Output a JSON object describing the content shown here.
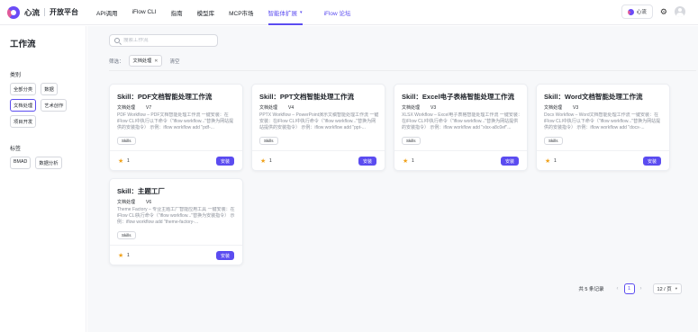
{
  "brand": {
    "name": "心流",
    "sub": "开放平台"
  },
  "nav": {
    "items": [
      {
        "label": "API调用"
      },
      {
        "label": "iFlow CLI"
      },
      {
        "label": "指南"
      },
      {
        "label": "模型库"
      },
      {
        "label": "MCP市场"
      }
    ],
    "active": {
      "label": "智能体扩展",
      "caret": "▾"
    },
    "forum": {
      "label": "iFlow 论坛"
    },
    "user_label": "心流",
    "icons": {
      "settings": "gear-icon",
      "avatar": "avatar-icon"
    }
  },
  "sidebar": {
    "title": "工作流",
    "category_title": "类别",
    "categories": [
      "全部分类",
      "数据",
      "文档处理",
      "艺术创作",
      "项目开发"
    ],
    "selected_category": "文档处理",
    "tag_title": "标签",
    "tags": [
      "BMAD",
      "数据分析"
    ]
  },
  "search": {
    "placeholder": "搜索工作流",
    "value": ""
  },
  "filter": {
    "label": "筛选：",
    "chip": "文档处理",
    "clear": "清空"
  },
  "cards": [
    {
      "title": "Skill：PDF文档智能处理工作流",
      "category": "文档处理",
      "version": "V7",
      "desc": "PDF Workflow – PDF文档智能处理工作流 一键安装：在iFlow CLI中执行以下命令（\"iflow workflow...\"替换为网站提供的安装指令）  示例：iflow workflow add \"pdf-...",
      "tag": "Skills",
      "stars": "1",
      "install": "安装"
    },
    {
      "title": "Skill：PPT文档智能处理工作流",
      "category": "文档处理",
      "version": "V4",
      "desc": "PPTX Workflow – PowerPoint演示文稿智能处理工作流 一键安装：在iFlow CLI中执行命令（\"iflow workflow...\"替换为网站提供的安装指令）  示例：iflow workflow add \"ppt-...",
      "tag": "Skills",
      "stars": "1",
      "install": "安装"
    },
    {
      "title": "Skill：Excel电子表格智能处理工作流",
      "category": "文档处理",
      "version": "V3",
      "desc": "XLSX Workflow – Excel电子表格智能处理工作流 一键安装：在iFlow CLI中执行命令（\"iflow workflow...\"替换为网站提供的安装指令）  示例：iflow workflow add \"xlsx-a8c0ef\"...",
      "tag": "Skills",
      "stars": "1",
      "install": "安装"
    },
    {
      "title": "Skill：Word文档智能处理工作流",
      "category": "文档处理",
      "version": "V3",
      "desc": "Docx Workflow – Word文档智能处理工作流 一键安装：在iFlow CLI中执行以下命令（\"iflow workflow...\"替换为网站提供的安装指令）  示例：iflow workflow add \"docx-...",
      "tag": "Skills",
      "stars": "1",
      "install": "安装"
    },
    {
      "title": "Skill：主题工厂",
      "category": "文档处理",
      "version": "V6",
      "desc": "Theme Factory – 专业主题工厂智能应用工具 一键安装：在iFlow CLI执行命令（\"iflow workflow...\"替换为安装指令）  示例：iflow workflow add \"theme-factory-...",
      "tag": "Skills",
      "stars": "1",
      "install": "安装"
    }
  ],
  "pagination": {
    "total": "共 5 条记录",
    "prev": "‹",
    "page": "1",
    "next": "›",
    "size": "12 / 页",
    "chevron": "▾"
  },
  "colors": {
    "accent": "#5b4cf0",
    "star": "#f0a21c"
  }
}
